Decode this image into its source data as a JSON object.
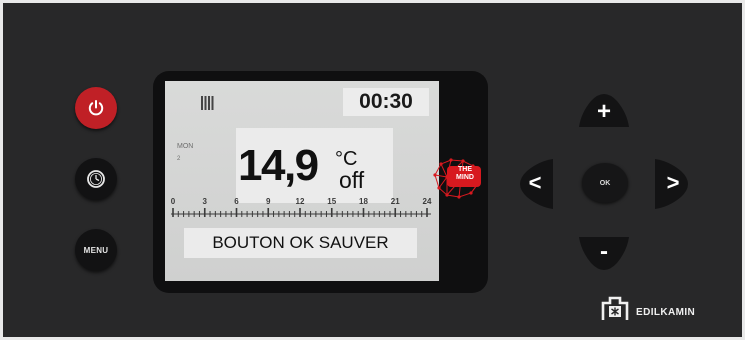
{
  "buttons": {
    "menu_label": "MENU",
    "ok_label": "OK",
    "plus_label": "+",
    "minus_label": "-",
    "left_label": "<",
    "right_label": ">"
  },
  "display": {
    "time": "00:30",
    "day": "MON",
    "day_number": "2",
    "temperature": "14,9",
    "unit": "°C",
    "status": "off",
    "scale_labels": [
      "0",
      "3",
      "6",
      "9",
      "12",
      "15",
      "18",
      "21",
      "24"
    ],
    "message": "BOUTON OK SAUVER"
  },
  "mind_logo": {
    "line1": "THE",
    "line2": "MIND"
  },
  "brand": {
    "name": "EDILKAMIN"
  },
  "colors": {
    "panel": "#282829",
    "power_button": "#c02026",
    "lcd": "#d5d6d5",
    "logo_red": "#d7191f"
  },
  "icons": [
    "power-icon",
    "clock-icon",
    "radiator-bars-icon",
    "the-mind-logo",
    "edilkamin-logo-icon"
  ]
}
